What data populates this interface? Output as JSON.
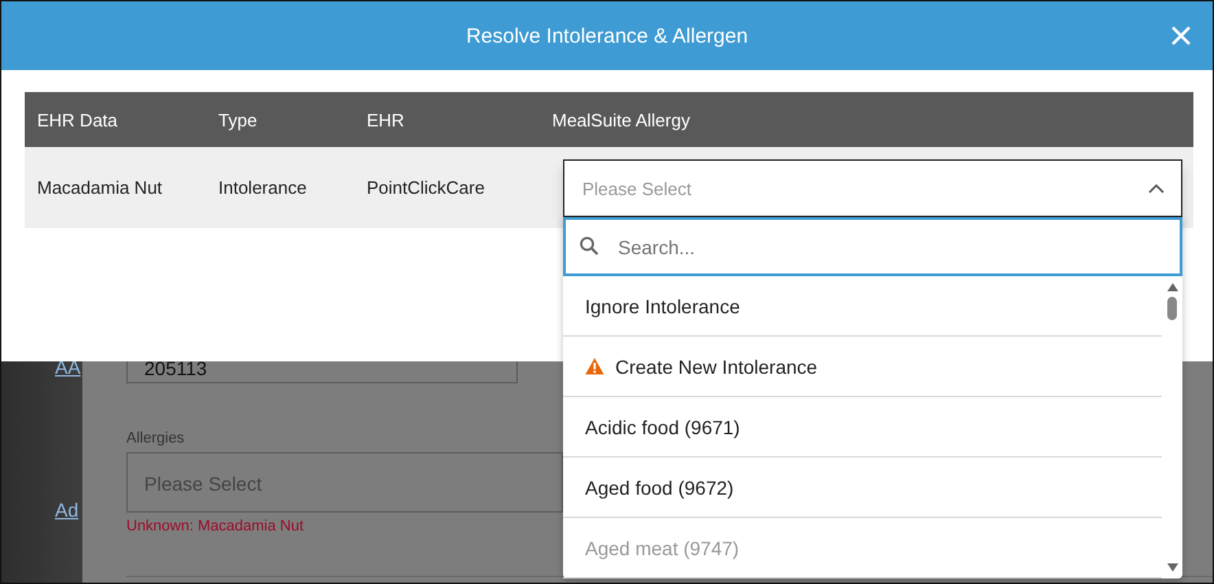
{
  "background_page": {
    "links": [
      "AA",
      "Ad"
    ],
    "id_field": {
      "value": "205113"
    },
    "allergies": {
      "label": "Allergies",
      "placeholder": "Please Select",
      "error": "Unknown: Macadamia Nut"
    }
  },
  "dialog": {
    "title": "Resolve Intolerance & Allergen",
    "table": {
      "columns": [
        "EHR Data",
        "Type",
        "EHR",
        "MealSuite Allergy"
      ],
      "rows": [
        {
          "ehr_data": "Macadamia Nut",
          "type": "Intolerance",
          "ehr": "PointClickCare",
          "mealsuite_allergy": {
            "placeholder": "Please Select",
            "expanded": true
          }
        }
      ]
    }
  },
  "dropdown": {
    "search": {
      "placeholder": "Search..."
    },
    "options": [
      {
        "kind": "option",
        "label": "Ignore Intolerance",
        "disabled": false
      },
      {
        "kind": "create",
        "label": "Create New Intolerance",
        "disabled": false
      },
      {
        "kind": "option",
        "label": "Acidic food (9671)",
        "disabled": false
      },
      {
        "kind": "option",
        "label": "Aged food (9672)",
        "disabled": false
      },
      {
        "kind": "option",
        "label": "Aged meat (9747)",
        "disabled": true
      }
    ]
  }
}
